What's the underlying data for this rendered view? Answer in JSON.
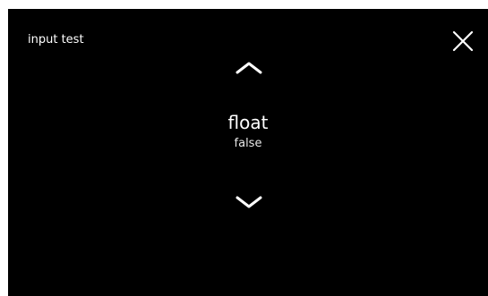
{
  "header": {
    "title": "input test",
    "close_icon": "close-icon"
  },
  "selector": {
    "up_icon": "chevron-up-icon",
    "down_icon": "chevron-down-icon",
    "label": "float",
    "value": "false"
  },
  "colors": {
    "background": "#000000",
    "foreground": "#ffffff"
  }
}
